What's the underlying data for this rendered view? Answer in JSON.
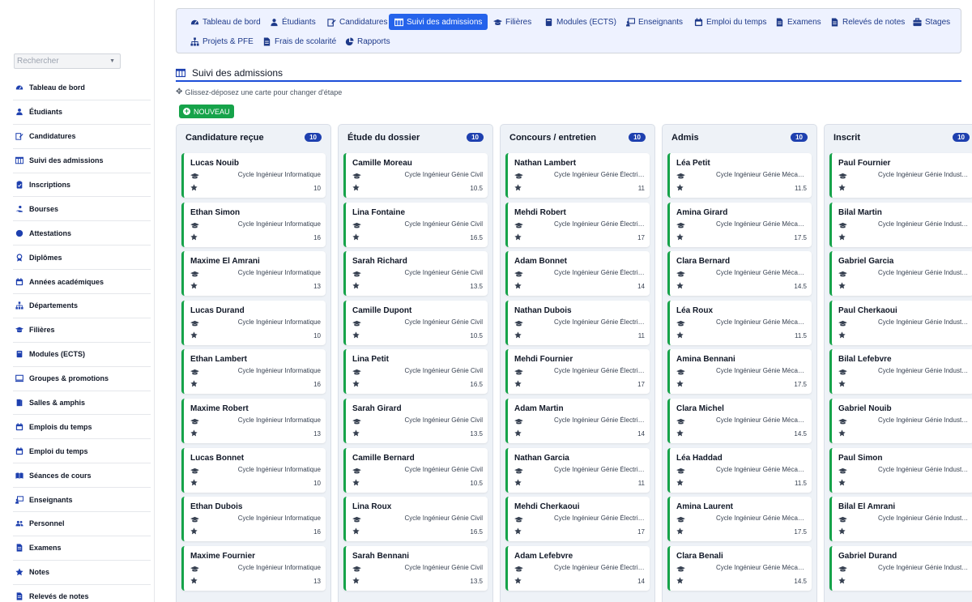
{
  "sidebar": {
    "search_placeholder": "Rechercher",
    "items": [
      {
        "label": "Tableau de bord",
        "icon": "dashboard-icon"
      },
      {
        "label": "Étudiants",
        "icon": "student-icon"
      },
      {
        "label": "Candidatures",
        "icon": "edit-icon"
      },
      {
        "label": "Suivi des admissions",
        "icon": "board-icon"
      },
      {
        "label": "Inscriptions",
        "icon": "clipboard-icon"
      },
      {
        "label": "Bourses",
        "icon": "hand-coin-icon"
      },
      {
        "label": "Attestations",
        "icon": "certificate-icon"
      },
      {
        "label": "Diplômes",
        "icon": "award-icon"
      },
      {
        "label": "Années académiques",
        "icon": "calendar-icon"
      },
      {
        "label": "Départements",
        "icon": "sitemap-icon"
      },
      {
        "label": "Filières",
        "icon": "graduation-cap-icon"
      },
      {
        "label": "Modules (ECTS)",
        "icon": "book-icon"
      },
      {
        "label": "Groupes & promotions",
        "icon": "screen-icon"
      },
      {
        "label": "Salles & amphis",
        "icon": "door-icon"
      },
      {
        "label": "Emplois du temps",
        "icon": "calendar-icon"
      },
      {
        "label": "Emploi du temps",
        "icon": "calendar-icon"
      },
      {
        "label": "Séances de cours",
        "icon": "open-book-icon"
      },
      {
        "label": "Enseignants",
        "icon": "teacher-icon"
      },
      {
        "label": "Personnel",
        "icon": "users-icon"
      },
      {
        "label": "Examens",
        "icon": "file-icon"
      },
      {
        "label": "Notes",
        "icon": "star-icon"
      },
      {
        "label": "Relevés de notes",
        "icon": "file-icon"
      }
    ]
  },
  "topnav": {
    "active_index": 3,
    "items": [
      {
        "label": "Tableau de bord",
        "icon": "dashboard-icon"
      },
      {
        "label": "Étudiants",
        "icon": "student-icon"
      },
      {
        "label": "Candidatures",
        "icon": "edit-icon"
      },
      {
        "label": "Suivi des admissions",
        "icon": "board-icon"
      },
      {
        "label": "Filières",
        "icon": "graduation-cap-icon"
      },
      {
        "label": "Modules (ECTS)",
        "icon": "book-icon"
      },
      {
        "label": "Enseignants",
        "icon": "teacher-icon"
      },
      {
        "label": "Emploi du temps",
        "icon": "calendar-icon"
      },
      {
        "label": "Examens",
        "icon": "file-icon"
      },
      {
        "label": "Relevés de notes",
        "icon": "file-icon"
      },
      {
        "label": "Stages",
        "icon": "briefcase-icon"
      },
      {
        "label": "Projets & PFE",
        "icon": "sitemap-icon"
      },
      {
        "label": "Frais de scolarité",
        "icon": "file-icon"
      },
      {
        "label": "Rapports",
        "icon": "pie-chart-icon"
      }
    ]
  },
  "page": {
    "title": "Suivi des admissions",
    "hint": "Glissez-déposez une carte pour changer d'étape",
    "new_button": "NOUVEAU"
  },
  "board": {
    "columns": [
      {
        "title": "Candidature reçue",
        "count": "10",
        "cards": [
          {
            "name": "Lucas Nouib",
            "program": "Cycle Ingénieur Informatique",
            "score": "10"
          },
          {
            "name": "Ethan Simon",
            "program": "Cycle Ingénieur Informatique",
            "score": "16"
          },
          {
            "name": "Maxime El Amrani",
            "program": "Cycle Ingénieur Informatique",
            "score": "13"
          },
          {
            "name": "Lucas Durand",
            "program": "Cycle Ingénieur Informatique",
            "score": "10"
          },
          {
            "name": "Ethan Lambert",
            "program": "Cycle Ingénieur Informatique",
            "score": "16"
          },
          {
            "name": "Maxime Robert",
            "program": "Cycle Ingénieur Informatique",
            "score": "13"
          },
          {
            "name": "Lucas Bonnet",
            "program": "Cycle Ingénieur Informatique",
            "score": "10"
          },
          {
            "name": "Ethan Dubois",
            "program": "Cycle Ingénieur Informatique",
            "score": "16"
          },
          {
            "name": "Maxime Fournier",
            "program": "Cycle Ingénieur Informatique",
            "score": "13"
          }
        ]
      },
      {
        "title": "Étude du dossier",
        "count": "10",
        "cards": [
          {
            "name": "Camille Moreau",
            "program": "Cycle Ingénieur Génie Civil",
            "score": "10.5"
          },
          {
            "name": "Lina Fontaine",
            "program": "Cycle Ingénieur Génie Civil",
            "score": "16.5"
          },
          {
            "name": "Sarah Richard",
            "program": "Cycle Ingénieur Génie Civil",
            "score": "13.5"
          },
          {
            "name": "Camille Dupont",
            "program": "Cycle Ingénieur Génie Civil",
            "score": "10.5"
          },
          {
            "name": "Lina Petit",
            "program": "Cycle Ingénieur Génie Civil",
            "score": "16.5"
          },
          {
            "name": "Sarah Girard",
            "program": "Cycle Ingénieur Génie Civil",
            "score": "13.5"
          },
          {
            "name": "Camille Bernard",
            "program": "Cycle Ingénieur Génie Civil",
            "score": "10.5"
          },
          {
            "name": "Lina Roux",
            "program": "Cycle Ingénieur Génie Civil",
            "score": "16.5"
          },
          {
            "name": "Sarah Bennani",
            "program": "Cycle Ingénieur Génie Civil",
            "score": "13.5"
          }
        ]
      },
      {
        "title": "Concours / entretien",
        "count": "10",
        "cards": [
          {
            "name": "Nathan Lambert",
            "program": "Cycle Ingénieur Génie Électrique",
            "score": "11"
          },
          {
            "name": "Mehdi Robert",
            "program": "Cycle Ingénieur Génie Électrique",
            "score": "17"
          },
          {
            "name": "Adam Bonnet",
            "program": "Cycle Ingénieur Génie Électrique",
            "score": "14"
          },
          {
            "name": "Nathan Dubois",
            "program": "Cycle Ingénieur Génie Électrique",
            "score": "11"
          },
          {
            "name": "Mehdi Fournier",
            "program": "Cycle Ingénieur Génie Électrique",
            "score": "17"
          },
          {
            "name": "Adam Martin",
            "program": "Cycle Ingénieur Génie Électrique",
            "score": "14"
          },
          {
            "name": "Nathan Garcia",
            "program": "Cycle Ingénieur Génie Électrique",
            "score": "11"
          },
          {
            "name": "Mehdi Cherkaoui",
            "program": "Cycle Ingénieur Génie Électrique",
            "score": "17"
          },
          {
            "name": "Adam Lefebvre",
            "program": "Cycle Ingénieur Génie Électrique",
            "score": "14"
          }
        ]
      },
      {
        "title": "Admis",
        "count": "10",
        "cards": [
          {
            "name": "Léa Petit",
            "program": "Cycle Ingénieur Génie Mécanique",
            "score": "11.5"
          },
          {
            "name": "Amina Girard",
            "program": "Cycle Ingénieur Génie Mécanique",
            "score": "17.5"
          },
          {
            "name": "Clara Bernard",
            "program": "Cycle Ingénieur Génie Mécanique",
            "score": "14.5"
          },
          {
            "name": "Léa Roux",
            "program": "Cycle Ingénieur Génie Mécanique",
            "score": "11.5"
          },
          {
            "name": "Amina Bennani",
            "program": "Cycle Ingénieur Génie Mécanique",
            "score": "17.5"
          },
          {
            "name": "Clara Michel",
            "program": "Cycle Ingénieur Génie Mécanique",
            "score": "14.5"
          },
          {
            "name": "Léa Haddad",
            "program": "Cycle Ingénieur Génie Mécanique",
            "score": "11.5"
          },
          {
            "name": "Amina Laurent",
            "program": "Cycle Ingénieur Génie Mécanique",
            "score": "17.5"
          },
          {
            "name": "Clara Benali",
            "program": "Cycle Ingénieur Génie Mécanique",
            "score": "14.5"
          }
        ]
      },
      {
        "title": "Inscrit",
        "count": "10",
        "cards": [
          {
            "name": "Paul Fournier",
            "program": "Cycle Ingénieur Génie Industriel",
            "score": ""
          },
          {
            "name": "Bilal Martin",
            "program": "Cycle Ingénieur Génie Industriel",
            "score": ""
          },
          {
            "name": "Gabriel Garcia",
            "program": "Cycle Ingénieur Génie Industriel",
            "score": ""
          },
          {
            "name": "Paul Cherkaoui",
            "program": "Cycle Ingénieur Génie Industriel",
            "score": ""
          },
          {
            "name": "Bilal Lefebvre",
            "program": "Cycle Ingénieur Génie Industriel",
            "score": ""
          },
          {
            "name": "Gabriel Nouib",
            "program": "Cycle Ingénieur Génie Industriel",
            "score": ""
          },
          {
            "name": "Paul Simon",
            "program": "Cycle Ingénieur Génie Industriel",
            "score": ""
          },
          {
            "name": "Bilal El Amrani",
            "program": "Cycle Ingénieur Génie Industriel",
            "score": ""
          },
          {
            "name": "Gabriel Durand",
            "program": "Cycle Ingénieur Génie Industriel",
            "score": ""
          }
        ]
      }
    ]
  },
  "colors": {
    "accent": "#2563eb",
    "nav_bg": "#eef2ff",
    "card_border": "#16a34a",
    "count_badge": "#1e40af",
    "column_bg": "#eef2f7"
  }
}
